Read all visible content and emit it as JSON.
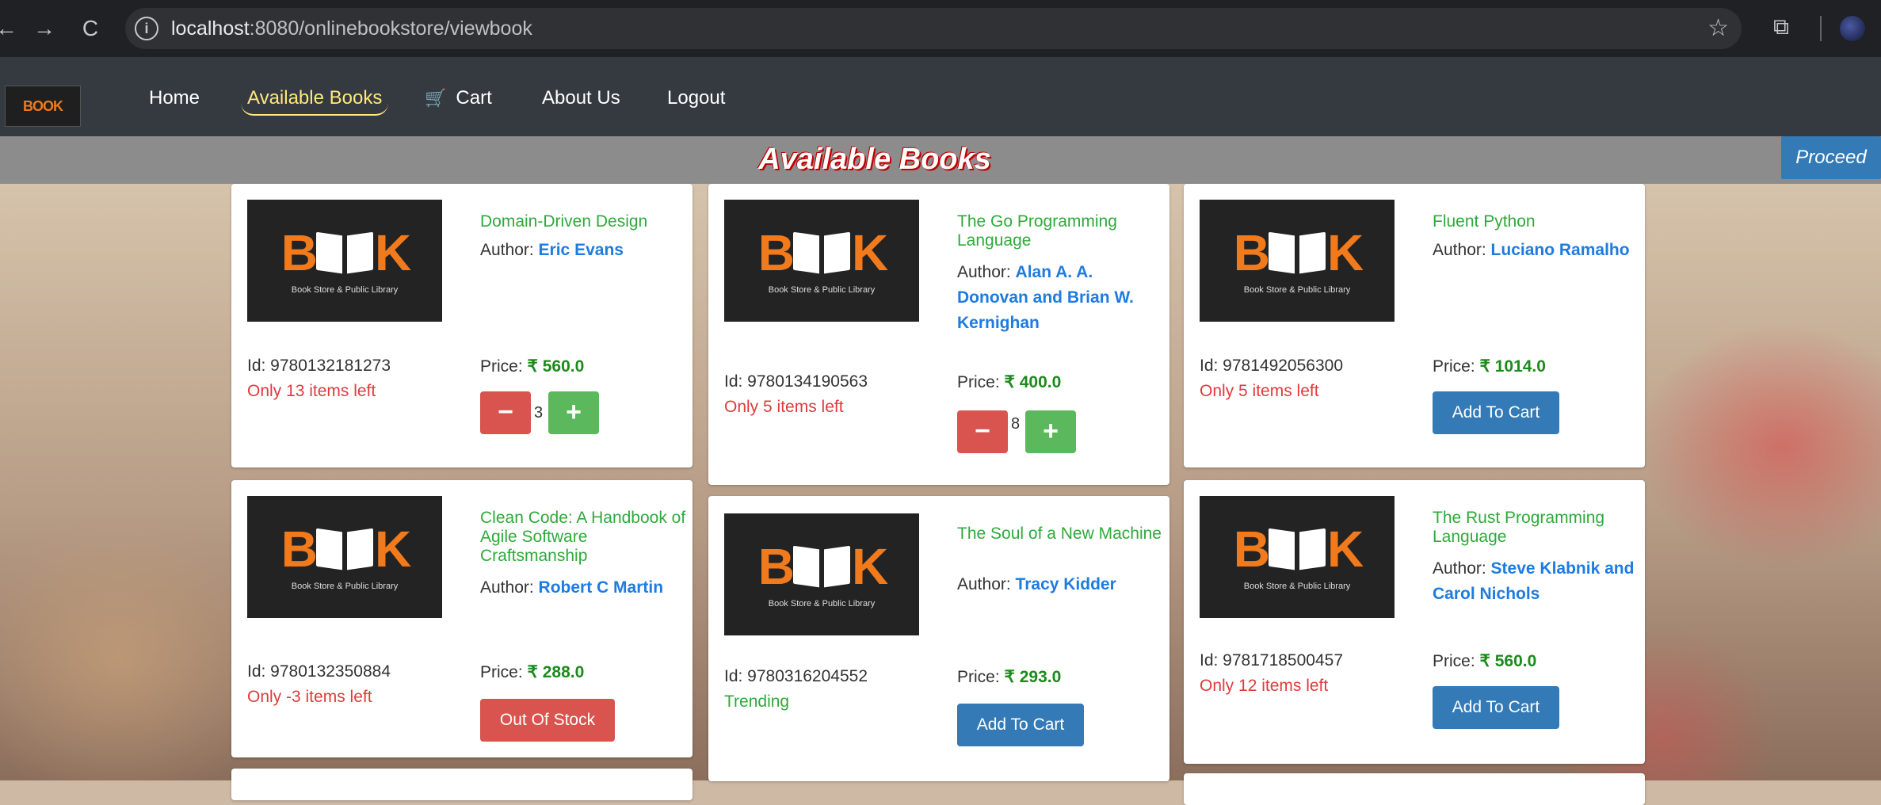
{
  "browser": {
    "url_host": "localhost",
    "url_rest": ":8080/onlinebookstore/viewbook",
    "back_icon": "←",
    "forward_icon": "→",
    "reload_icon": "C",
    "info_icon": "i",
    "star_icon": "☆",
    "ext_icon": "⧉"
  },
  "navbar": {
    "logo": "BOOK",
    "items": [
      "Home",
      "Available Books",
      "Cart",
      "About Us",
      "Logout"
    ],
    "cart_icon": "🛒"
  },
  "banner": {
    "title": "Available Books",
    "proceed": "Proceed"
  },
  "cover": {
    "letters_left": "B",
    "letters_right": "K",
    "subtitle": "Book Store & Public Library"
  },
  "books": [
    {
      "title": "Domain-Driven Design",
      "author_label": "Author: ",
      "author": "Eric Evans",
      "id": "Id: 9780132181273",
      "stock": "Only 13 items left",
      "price_label": "Price: ",
      "price": "₹ 560.0",
      "qty": "3"
    },
    {
      "title": "The Go Programming Language",
      "author_label": "Author: ",
      "author": "Alan A. A. Donovan and Brian W. Kernighan",
      "id": "Id: 9780134190563",
      "stock": "Only 5 items left",
      "price_label": "Price: ",
      "price": "₹ 400.0",
      "qty": "8"
    },
    {
      "title": "Fluent Python",
      "author_label": "Author: ",
      "author": "Luciano Ramalho",
      "id": "Id: 9781492056300",
      "stock": "Only 5 items left",
      "price_label": "Price: ",
      "price": "₹ 1014.0",
      "button": "Add To Cart"
    },
    {
      "title": "Clean Code: A Handbook of Agile Software Craftsmanship",
      "author_label": "Author: ",
      "author": "Robert C Martin",
      "id": "Id: 9780132350884",
      "stock": "Only -3 items left",
      "price_label": "Price: ",
      "price": "₹ 288.0",
      "button": "Out Of Stock"
    },
    {
      "title": "The Soul of a New Machine",
      "author_label": "Author: ",
      "author": "Tracy Kidder",
      "id": "Id: 9780316204552",
      "stock": "Trending",
      "price_label": "Price: ",
      "price": "₹ 293.0",
      "button": "Add To Cart"
    },
    {
      "title": "The Rust Programming Language",
      "author_label": "Author: ",
      "author": "Steve Klabnik and Carol Nichols",
      "id": "Id: 9781718500457",
      "stock": "Only 12 items left",
      "price_label": "Price: ",
      "price": "₹ 560.0",
      "button": "Add To Cart"
    }
  ],
  "qty_controls": {
    "minus": "−",
    "plus": "+"
  },
  "colors": {
    "navbar": "#343a40",
    "active_nav": "#ffe87a",
    "title_green": "#2eaa3a",
    "author_blue": "#1e7be0",
    "price_green": "#1c8a1c",
    "stock_red": "#e03a3a",
    "primary": "#337ab7",
    "danger": "#d9534f",
    "success": "#5cb85c"
  }
}
